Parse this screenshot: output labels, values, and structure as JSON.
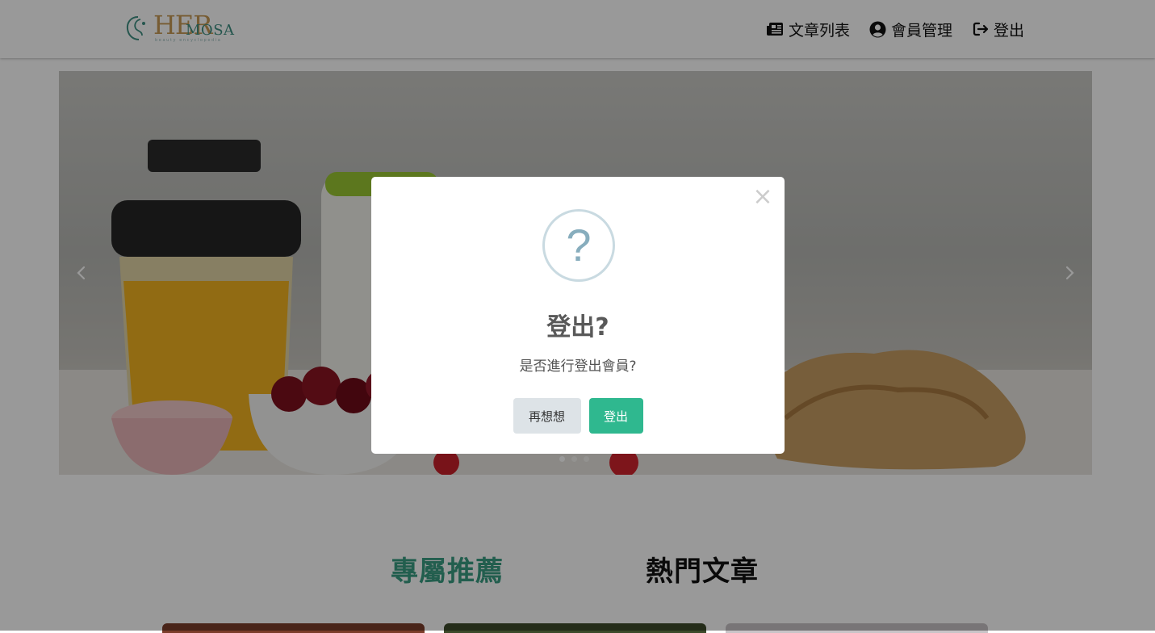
{
  "header": {
    "logo": {
      "word_her": "HER",
      "word_mosa": "MOSA",
      "tagline": "beauty encyclopedia"
    },
    "nav": [
      {
        "label": "文章列表",
        "icon": "newspaper-icon"
      },
      {
        "label": "會員管理",
        "icon": "user-circle-icon"
      },
      {
        "label": "登出",
        "icon": "logout-icon"
      }
    ]
  },
  "carousel": {
    "slide_count": 3,
    "active_index": 0
  },
  "sections": {
    "tabs": [
      "專屬推薦",
      "熱門文章"
    ],
    "active_tab": "專屬推薦"
  },
  "modal": {
    "icon": "question-icon",
    "icon_glyph": "?",
    "close_glyph": "×",
    "title": "登出?",
    "text": "是否進行登出會員?",
    "cancel_label": "再想想",
    "confirm_label": "登出"
  },
  "colors": {
    "accent": "#2fb88f",
    "tab_active": "#3a9d82",
    "logo_gold": "#c79a55",
    "logo_teal": "#3f8f82",
    "question_ring": "#c9dae1",
    "question_mark": "#87adbd"
  }
}
